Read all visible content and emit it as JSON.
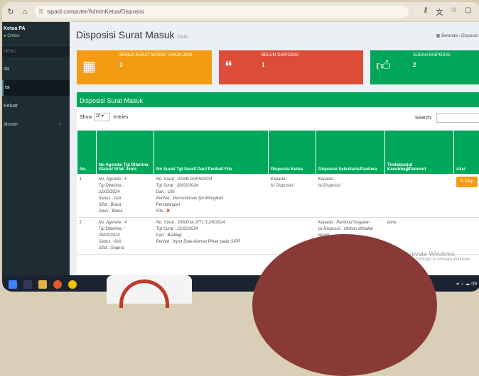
{
  "browser": {
    "url": "sipadi.computer/AdminKetua/Disposisi"
  },
  "sidebar": {
    "user": "Ketua PA",
    "status": "Online",
    "header": "MENU",
    "items": [
      {
        "label": "da",
        "active": false,
        "caret": ""
      },
      {
        "label": "isi",
        "active": true,
        "caret": ""
      },
      {
        "label": "Keluar",
        "active": false,
        "caret": ""
      },
      {
        "label": "aturan",
        "active": false,
        "caret": "‹"
      }
    ]
  },
  "page": {
    "title": "Disposisi Surat Masuk",
    "subtitle": "Data",
    "breadcrumb": "Beranda  ›  Disposisi"
  },
  "stat_boxes": [
    {
      "label": "SEMUA SURAT MASUK TAHUN 2024",
      "value": "3",
      "icon": "calendar-icon",
      "color": "#f39c12"
    },
    {
      "label": "BELUM DISPOSISI",
      "value": "1",
      "icon": "comments-icon",
      "color": "#dd4b39"
    },
    {
      "label": "SUDAH DISPOSISI",
      "value": "2",
      "icon": "thumbs-up-icon",
      "color": "#00a65a"
    }
  ],
  "panel": {
    "title": "Disposisi Surat Masuk",
    "show_label": "Show",
    "entries_value": "10",
    "entries_label": "entries",
    "search_label": "Search:"
  },
  "table": {
    "headers": [
      "No.",
      "No Agenda/ Tgl Diterima Status/ Sifat/ Jenis",
      "No Surat/ Tgl Surat/ Dari/ Perihal/ File",
      "Disposisi Ketua",
      "Disposisi Sekretaris/Panitera",
      "Tindaklanjut Kasubbag/Panmud",
      "Aksi"
    ],
    "rows": [
      {
        "no": "1",
        "agenda": [
          "No. Agenda : 5",
          "Tgl Diterima :",
          "22/02/2024",
          "Status : Asli",
          "Sifat : Biasa",
          "Jenis : Biasa"
        ],
        "surat": [
          "No. Surat : 018/B.02/FH/2024",
          "Tgl Surat : 20/02/2024",
          "Dari : USI",
          "Perihal : Permohonan Ijin Mengikuti",
          "Persidangan",
          "File : "
        ],
        "ketua": [
          "Kepada :",
          "Isi Disposisi :"
        ],
        "sekretaris": [
          "Kepada :",
          "Isi Disposisi :"
        ],
        "tindaklanjut": [],
        "aksi": "Disp"
      },
      {
        "no": "2",
        "agenda": [
          "No. Agenda : 4",
          "Tgl Diterima :",
          "20/02/2024",
          "Status : Asli",
          "Sifat : Segera"
        ],
        "surat": [
          "No. Surat : 298/DJA.3/T1.3.2/II/2024",
          "Tgl Surat : 15/02/2024",
          "Dari : Badilag",
          "Perihal : Input Data Alamat Pihak pada SIPP"
        ],
        "ketua": [],
        "sekretaris": [
          "Kepada : Panmud Gugatan",
          "Isi Disposisi : Mohon ditindak lanjuti"
        ],
        "tindaklanjut": [
          "done"
        ],
        "aksi": ""
      }
    ]
  },
  "watermark": {
    "title": "Activate Windows",
    "subtitle": "Go to Settings to activate Windows."
  },
  "taskbar": {
    "tray": "⏶ ♪ ☁ 09"
  }
}
